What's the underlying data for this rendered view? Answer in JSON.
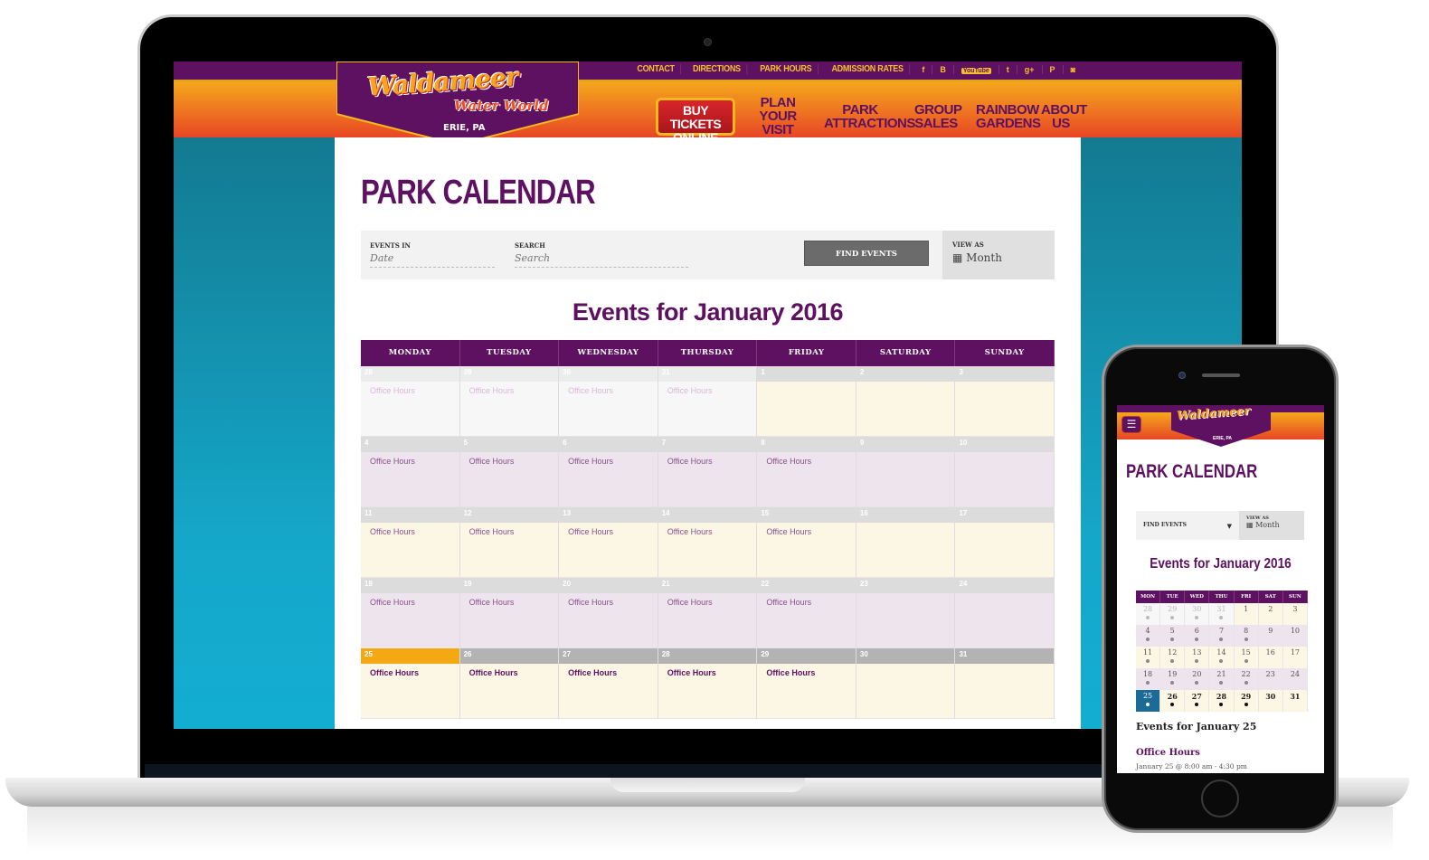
{
  "site": {
    "logo_main": "Waldameer",
    "logo_sub": "Water World",
    "logo_location": "ERIE, PA",
    "brand_colors": {
      "purple": "#5e1061",
      "orange": "#ee6e22",
      "gold": "#f5c12a",
      "red": "#c0241f",
      "teal": "#15a7c9"
    }
  },
  "utility_nav": [
    "CONTACT",
    "DIRECTIONS",
    "PARK HOURS",
    "ADMISSION RATES"
  ],
  "social_icons": [
    {
      "name": "facebook-icon",
      "glyph": "f"
    },
    {
      "name": "blogger-icon",
      "glyph": "B"
    },
    {
      "name": "youtube-icon",
      "glyph": "YouTube"
    },
    {
      "name": "twitter-icon",
      "glyph": "t"
    },
    {
      "name": "google-plus-icon",
      "glyph": "g+"
    },
    {
      "name": "pinterest-icon",
      "glyph": "P"
    },
    {
      "name": "instagram-icon",
      "glyph": "◙"
    }
  ],
  "main_nav": {
    "buy_line1": "BUY TICKETS",
    "buy_line2": "ONLINE",
    "items": [
      {
        "l1": "PLAN YOUR",
        "l2": "VISIT"
      },
      {
        "l1": "PARK",
        "l2": "ATTRACTIONS"
      },
      {
        "l1": "GROUP",
        "l2": "SALES"
      },
      {
        "l1": "RAINBOW",
        "l2": "GARDENS"
      },
      {
        "l1": "ABOUT",
        "l2": "US"
      }
    ]
  },
  "page": {
    "title": "PARK CALENDAR",
    "filters": {
      "events_in_label": "EVENTS IN",
      "events_in_placeholder": "Date",
      "search_label": "SEARCH",
      "search_placeholder": "Search",
      "find_button": "FIND EVENTS",
      "view_as_label": "VIEW AS",
      "view_as_value": "Month",
      "calendar_icon": "▦"
    },
    "month_title": "Events for January 2016",
    "weekdays": [
      "MONDAY",
      "TUESDAY",
      "WEDNESDAY",
      "THURSDAY",
      "FRIDAY",
      "SATURDAY",
      "SUNDAY"
    ],
    "event_name": "Office Hours",
    "weeks": [
      [
        {
          "d": "28",
          "ev": true,
          "t": "past"
        },
        {
          "d": "29",
          "ev": true,
          "t": "past"
        },
        {
          "d": "30",
          "ev": true,
          "t": "past"
        },
        {
          "d": "31",
          "ev": true,
          "t": "past"
        },
        {
          "d": "1",
          "ev": false,
          "t": "cream"
        },
        {
          "d": "2",
          "ev": false,
          "t": "cream"
        },
        {
          "d": "3",
          "ev": false,
          "t": "cream"
        }
      ],
      [
        {
          "d": "4",
          "ev": true,
          "t": "lav"
        },
        {
          "d": "5",
          "ev": true,
          "t": "lav"
        },
        {
          "d": "6",
          "ev": true,
          "t": "lav"
        },
        {
          "d": "7",
          "ev": true,
          "t": "lav"
        },
        {
          "d": "8",
          "ev": true,
          "t": "lav"
        },
        {
          "d": "9",
          "ev": false,
          "t": "lav"
        },
        {
          "d": "10",
          "ev": false,
          "t": "lav"
        }
      ],
      [
        {
          "d": "11",
          "ev": true,
          "t": "cream"
        },
        {
          "d": "12",
          "ev": true,
          "t": "cream"
        },
        {
          "d": "13",
          "ev": true,
          "t": "cream"
        },
        {
          "d": "14",
          "ev": true,
          "t": "cream"
        },
        {
          "d": "15",
          "ev": true,
          "t": "cream"
        },
        {
          "d": "16",
          "ev": false,
          "t": "cream"
        },
        {
          "d": "17",
          "ev": false,
          "t": "cream"
        }
      ],
      [
        {
          "d": "18",
          "ev": true,
          "t": "lav"
        },
        {
          "d": "19",
          "ev": true,
          "t": "lav"
        },
        {
          "d": "20",
          "ev": true,
          "t": "lav"
        },
        {
          "d": "21",
          "ev": true,
          "t": "lav"
        },
        {
          "d": "22",
          "ev": true,
          "t": "lav"
        },
        {
          "d": "23",
          "ev": false,
          "t": "lav"
        },
        {
          "d": "24",
          "ev": false,
          "t": "lav"
        }
      ],
      [
        {
          "d": "25",
          "ev": true,
          "t": "today"
        },
        {
          "d": "26",
          "ev": true,
          "t": "cur"
        },
        {
          "d": "27",
          "ev": true,
          "t": "cur"
        },
        {
          "d": "28",
          "ev": true,
          "t": "cur"
        },
        {
          "d": "29",
          "ev": true,
          "t": "cur"
        },
        {
          "d": "30",
          "ev": false,
          "t": "cur"
        },
        {
          "d": "31",
          "ev": false,
          "t": "cur"
        }
      ]
    ]
  },
  "mobile": {
    "menu_icon": "☰",
    "title": "PARK CALENDAR",
    "find_events": "FIND EVENTS",
    "caret": "▼",
    "view_as_label": "VIEW AS",
    "view_as_value": "Month",
    "month_title": "Events for January 2016",
    "weekdays": [
      "MON",
      "TUE",
      "WED",
      "THU",
      "FRI",
      "SAT",
      "SUN"
    ],
    "day_title": "Events for January 25",
    "event_title": "Office Hours",
    "event_time": "January 25 @ 8:00 am - 4:30 pm"
  }
}
